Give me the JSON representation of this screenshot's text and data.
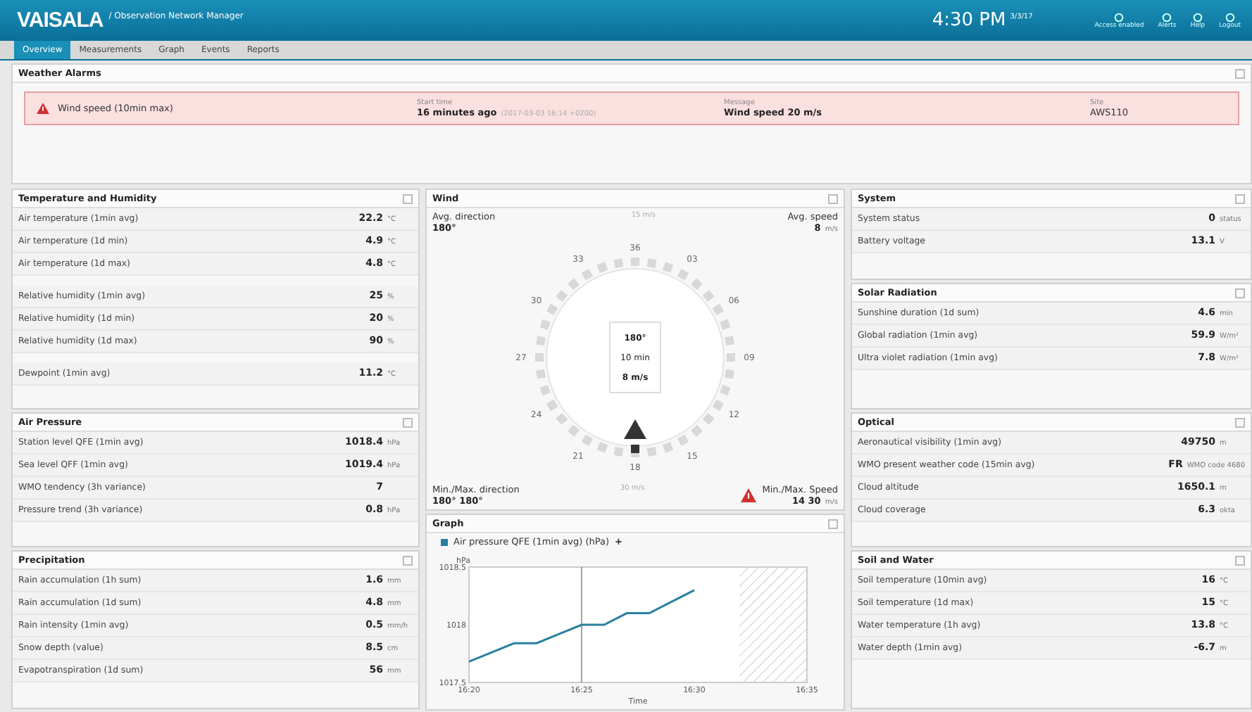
{
  "header": {
    "logo": "VAISALA",
    "app_title": "/ Observation Network Manager",
    "time": "4:30 PM",
    "date": "3/3/17",
    "actions": [
      {
        "label": "Access enabled"
      },
      {
        "label": "Alerts"
      },
      {
        "label": "Help"
      },
      {
        "label": "Logout"
      }
    ]
  },
  "tabs": [
    {
      "label": "Overview",
      "selected": true
    },
    {
      "label": "Measurements",
      "selected": false
    },
    {
      "label": "Graph",
      "selected": false
    },
    {
      "label": "Events",
      "selected": false
    },
    {
      "label": "Reports",
      "selected": false
    }
  ],
  "alarms": {
    "title": "Weather Alarms",
    "items": [
      {
        "name": "Wind speed (10min max)",
        "start_label": "Start time",
        "start": "16 minutes ago",
        "start_detail": "(2017-03-03 16:14 +0200)",
        "message_label": "Message",
        "message": "Wind speed 20 m/s",
        "site_label": "Site",
        "site": "AWS110"
      }
    ]
  },
  "left": [
    {
      "title": "Temperature and Humidity",
      "groups": [
        [
          {
            "label": "Air temperature (1min avg)",
            "value": "22.2",
            "unit": "°C"
          },
          {
            "label": "Air temperature (1d min)",
            "value": "4.9",
            "unit": "°C"
          },
          {
            "label": "Air temperature (1d max)",
            "value": "4.8",
            "unit": "°C"
          }
        ],
        [
          {
            "label": "Relative humidity (1min avg)",
            "value": "25",
            "unit": "%"
          },
          {
            "label": "Relative humidity (1d min)",
            "value": "20",
            "unit": "%"
          },
          {
            "label": "Relative humidity (1d max)",
            "value": "90",
            "unit": "%"
          }
        ],
        [
          {
            "label": "Dewpoint (1min avg)",
            "value": "11.2",
            "unit": "°C"
          }
        ]
      ]
    },
    {
      "title": "Air Pressure",
      "groups": [
        [
          {
            "label": "Station level QFE (1min avg)",
            "value": "1018.4",
            "unit": "hPa"
          },
          {
            "label": "Sea level QFF (1min avg)",
            "value": "1019.4",
            "unit": "hPa"
          },
          {
            "label": "WMO tendency (3h variance)",
            "value": "7"
          },
          {
            "label": "Pressure trend (3h variance)",
            "value": "0.8",
            "unit": "hPa"
          }
        ]
      ]
    },
    {
      "title": "Precipitation",
      "groups": [
        [
          {
            "label": "Rain accumulation (1h sum)",
            "value": "1.6",
            "unit": "mm"
          },
          {
            "label": "Rain accumulation (1d sum)",
            "value": "4.8",
            "unit": "mm"
          },
          {
            "label": "Rain intensity (1min avg)",
            "value": "0.5",
            "unit": "mm/h"
          },
          {
            "label": "Snow depth (value)",
            "value": "8.5",
            "unit": "cm"
          },
          {
            "label": "Evapotranspiration (1d sum)",
            "value": "56",
            "unit": "mm"
          }
        ]
      ]
    }
  ],
  "wind": {
    "title": "Wind",
    "avg_direction_label": "Avg. direction",
    "avg_direction": "180°",
    "avg_speed_label": "Avg. speed",
    "avg_speed": "8",
    "avg_speed_unit": "m/s",
    "scale_top": "15 m/s",
    "scale_bottom": "30 m/s",
    "compass": [
      "36",
      "03",
      "06",
      "09",
      "12",
      "15",
      "18",
      "21",
      "24",
      "27",
      "30",
      "33"
    ],
    "center": [
      "180°",
      "10 min",
      "8 m/s"
    ],
    "minmax_direction_label": "Min./Max. direction",
    "min_direction": "180°",
    "max_direction": "180°",
    "minmax_speed_label": "Min./Max. Speed",
    "min_speed": "14",
    "max_speed": "30",
    "speed_unit": "m/s",
    "speed_alarm": true
  },
  "graph": {
    "title": "Graph",
    "add": "+",
    "chart_data": {
      "type": "line",
      "xlabel": "Time",
      "ylabel": "hPa",
      "categories": [
        "16:20",
        null,
        null,
        null,
        null,
        "16:25",
        null,
        null,
        null,
        null,
        "16:30",
        null,
        null,
        null,
        null,
        "16:35"
      ],
      "series": [
        {
          "name": "Air pressure QFE (1min avg) (hPa)",
          "color": "#2a7fa0",
          "values": [
            1017.68,
            1017.76,
            1017.84,
            1017.84,
            1017.92,
            1018.0,
            1018.0,
            1018.1,
            1018.1,
            1018.2,
            1018.3,
            null,
            null,
            null,
            null,
            null
          ]
        }
      ],
      "ylim": [
        1017.5,
        1018.5
      ],
      "yticks": [
        {
          "value": 1017.5,
          "label": "1017.5"
        },
        {
          "value": 1018,
          "label": "1018"
        },
        {
          "value": 1018.5,
          "label": "1018.5"
        }
      ]
    }
  },
  "right": [
    {
      "title": "System",
      "groups": [
        [
          {
            "label": "System status",
            "value": "0",
            "unit": "status"
          },
          {
            "label": "Battery voltage",
            "value": "13.1",
            "unit": "V"
          }
        ]
      ]
    },
    {
      "title": "Solar Radiation",
      "groups": [
        [
          {
            "label": "Sunshine duration (1d sum)",
            "value": "4.6",
            "unit": "min"
          },
          {
            "label": "Global radiation (1min avg)",
            "value": "59.9",
            "unit": "W/m²"
          },
          {
            "label": "Ultra violet radiation (1min avg)",
            "value": "7.8",
            "unit": "W/m²"
          }
        ]
      ]
    },
    {
      "title": "Optical",
      "groups": [
        [
          {
            "label": "Aeronautical visibility (1min avg)",
            "value": "49750",
            "unit": "m"
          },
          {
            "label": "WMO present weather code (15min avg)",
            "value": "FR",
            "unit": "WMO code 4680"
          },
          {
            "label": "Cloud altitude",
            "value": "1650.1",
            "unit": "m"
          },
          {
            "label": "Cloud coverage",
            "value": "6.3",
            "unit": "okta"
          }
        ]
      ]
    },
    {
      "title": "Soil and Water",
      "groups": [
        [
          {
            "label": "Soil temperature (10min avg)",
            "value": "16",
            "unit": "°C"
          },
          {
            "label": "Soil temperature (1d max)",
            "value": "15",
            "unit": "°C"
          },
          {
            "label": "Water temperature (1h avg)",
            "value": "13.8",
            "unit": "°C"
          },
          {
            "label": "Water depth (1min avg)",
            "value": "-6.7",
            "unit": "m"
          }
        ]
      ]
    }
  ]
}
